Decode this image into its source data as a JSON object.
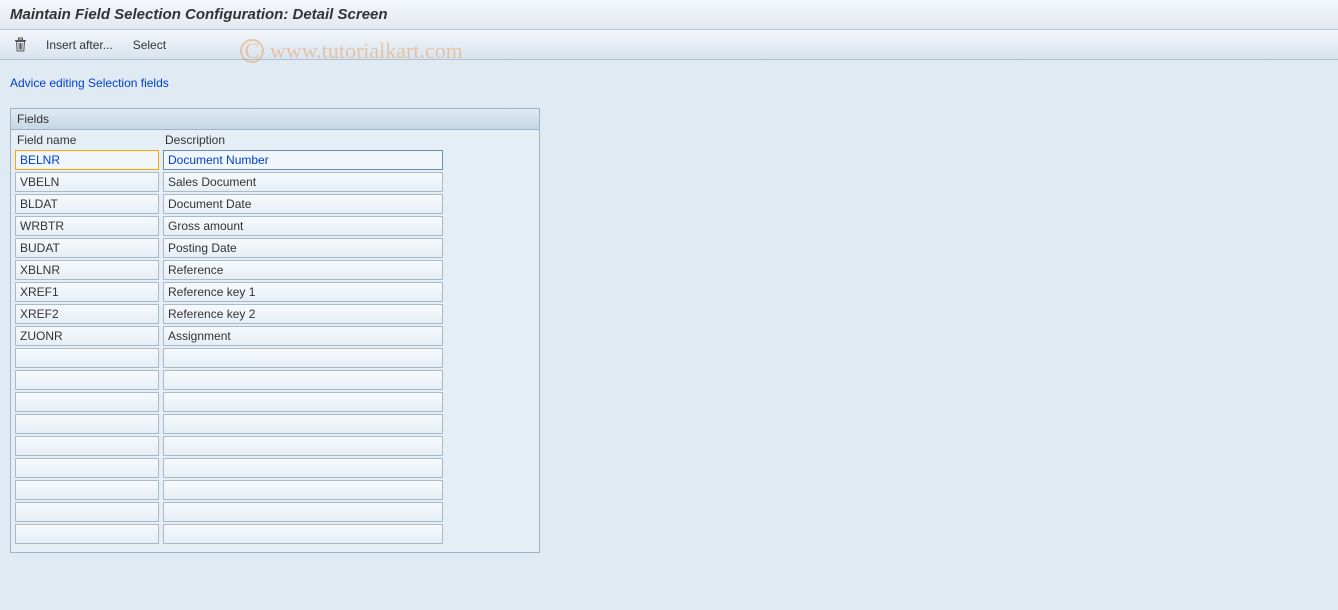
{
  "header": {
    "title": "Maintain Field Selection Configuration: Detail Screen"
  },
  "toolbar": {
    "delete_icon": "trash-icon",
    "insert_after_label": "Insert after...",
    "select_label": "Select"
  },
  "subheading": "Advice editing Selection fields",
  "panel": {
    "title": "Fields",
    "columns": {
      "name": "Field name",
      "desc": "Description"
    },
    "rows": [
      {
        "name": "BELNR",
        "desc": "Document Number",
        "selected": true
      },
      {
        "name": "VBELN",
        "desc": "Sales Document",
        "selected": false
      },
      {
        "name": "BLDAT",
        "desc": "Document Date",
        "selected": false
      },
      {
        "name": "WRBTR",
        "desc": "Gross amount",
        "selected": false
      },
      {
        "name": "BUDAT",
        "desc": "Posting Date",
        "selected": false
      },
      {
        "name": "XBLNR",
        "desc": "Reference",
        "selected": false
      },
      {
        "name": "XREF1",
        "desc": "Reference key 1",
        "selected": false
      },
      {
        "name": "XREF2",
        "desc": "Reference key 2",
        "selected": false
      },
      {
        "name": "ZUONR",
        "desc": "Assignment",
        "selected": false
      },
      {
        "name": "",
        "desc": "",
        "selected": false
      },
      {
        "name": "",
        "desc": "",
        "selected": false
      },
      {
        "name": "",
        "desc": "",
        "selected": false
      },
      {
        "name": "",
        "desc": "",
        "selected": false
      },
      {
        "name": "",
        "desc": "",
        "selected": false
      },
      {
        "name": "",
        "desc": "",
        "selected": false
      },
      {
        "name": "",
        "desc": "",
        "selected": false
      },
      {
        "name": "",
        "desc": "",
        "selected": false
      },
      {
        "name": "",
        "desc": "",
        "selected": false
      }
    ]
  },
  "watermark": "www.tutorialkart.com"
}
